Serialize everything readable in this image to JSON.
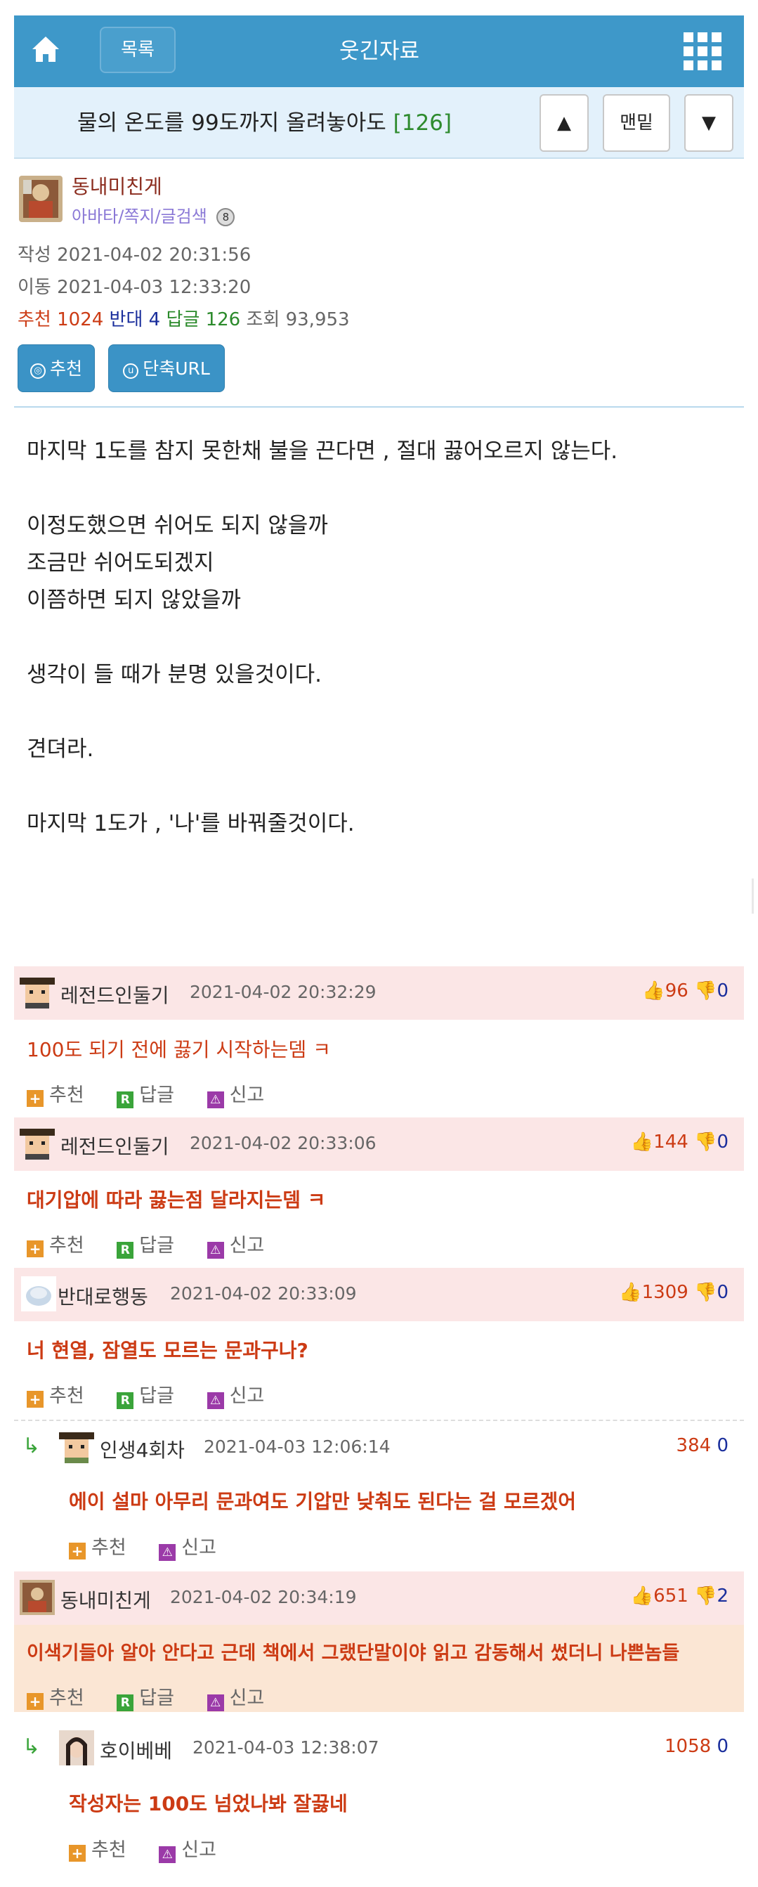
{
  "nav": {
    "list_label": "목록",
    "board_title": "웃긴자료"
  },
  "post": {
    "title": "물의 온도를 99도까지 올려놓아도",
    "reply_count_bracket": "[126]",
    "nav_up": "▲",
    "nav_bottom": "맨밑",
    "nav_down": "▼"
  },
  "author": {
    "name": "동내미친게",
    "links": "아바타/쪽지/글검색",
    "badge": "8",
    "written_label": "작성",
    "written": "2021-04-02 20:31:56",
    "moved_label": "이동",
    "moved": "2021-04-03 12:33:20",
    "rec_label": "추천",
    "rec": "1024",
    "opp_label": "반대",
    "opp": "4",
    "reply_label": "답글",
    "reply": "126",
    "views_label": "조회",
    "views": "93,953"
  },
  "actions": {
    "recommend": "추천",
    "short_url": "단축URL"
  },
  "body_lines": [
    "마지막 1도를 참지 못한채 불을 끈다면 , 절대 끓어오르지 않는다.",
    "이정도했으면 쉬어도 되지 않을까",
    "조금만 쉬어도되겠지",
    "이쯤하면 되지 않았을까",
    "생각이 들 때가 분명 있을것이다.",
    "견뎌라.",
    "마지막 1도가 , '나'를 바꿔줄것이다."
  ],
  "comment_actions": {
    "recommend": "추천",
    "reply": "답글",
    "report": "신고"
  },
  "comments": [
    {
      "name": "레전드인둘기",
      "date": "2021-04-02 20:32:29",
      "up": "96",
      "down": "0",
      "text": "100도 되기 전에 끓기 시작하는뎀 ㅋ"
    },
    {
      "name": "레전드인둘기",
      "date": "2021-04-02 20:33:06",
      "up": "144",
      "down": "0",
      "text": "대기압에 따라 끓는점 달라지는뎀 ㅋ"
    },
    {
      "name": "반대로행동",
      "date": "2021-04-02 20:33:09",
      "up": "1309",
      "down": "0",
      "text": "너 현열, 잠열도 모르는 문과구나?"
    },
    {
      "name": "인생4회차",
      "date": "2021-04-03 12:06:14",
      "up": "384",
      "down": "0",
      "text": "에이 설마 아무리 문과여도 기압만 낮춰도 된다는 걸 모르겠어"
    },
    {
      "name": "동내미친게",
      "date": "2021-04-02 20:34:19",
      "up": "651",
      "down": "2",
      "text": "이색기들아 알아 안다고 근데 책에서 그랬단말이야 읽고 감동해서 썼더니 나쁜놈들"
    },
    {
      "name": "호이베베",
      "date": "2021-04-03 12:38:07",
      "up": "1058",
      "down": "0",
      "text": "작성자는 100도 넘었나봐 잘끓네"
    }
  ],
  "colors": {
    "nav_blue": "#3e98c9",
    "title_bg": "#e3f1fb",
    "comment_head_bg": "#fbe6e6",
    "author_comment_bg": "#fbe6d4",
    "red_text": "#cc3b14",
    "blue_text": "#1a2e9c",
    "green_text": "#2b8a2b"
  }
}
